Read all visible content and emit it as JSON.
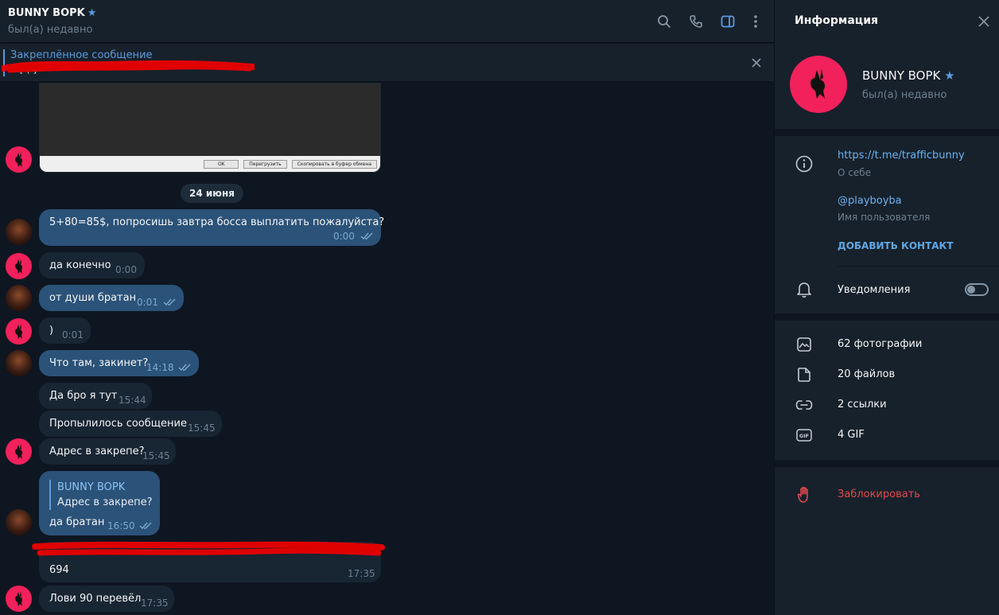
{
  "header": {
    "name": "BUNNY BOPK",
    "status": "был(а) недавно"
  },
  "pinned": {
    "title": "Закреплённое сообщение",
    "text": "1 [  (             ]"
  },
  "screenshot": {
    "ok_label": "OK",
    "reload_label": "Перегрузить",
    "copy_label": "Скопировать в буфер обмена"
  },
  "date_chip": "24 июня",
  "messages": [
    {
      "text": "5+80=85$, попросишь завтра босса выплатить пожалуйста?",
      "time": "0:00"
    },
    {
      "text": "да конечно",
      "time": "0:00"
    },
    {
      "text": "от души братан",
      "time": "0:01"
    },
    {
      "text": ")",
      "time": "0:01"
    },
    {
      "text": "Что там, закинет?",
      "time": "14:18"
    },
    {
      "text": "Да бро я тут",
      "time": "15:44"
    },
    {
      "text": "Пропылилось сообщение",
      "time": "15:45"
    },
    {
      "text": "Адрес в закрепе?",
      "time": "15:45"
    },
    {
      "text": "да братан",
      "time": "16:50",
      "reply_name": "BUNNY BOPK",
      "reply_text": "Адрес в закрепе?"
    },
    {
      "text": "694",
      "time": "17:35"
    },
    {
      "text": "Лови 90 перевёл",
      "time": "17:35"
    }
  ],
  "info": {
    "title": "Информация",
    "name": "BUNNY BOPK",
    "status": "был(а) недавно",
    "link": "https://t.me/trafficbunny",
    "link_label": "О себе",
    "username": "@playboyba",
    "username_label": "Имя пользователя",
    "add_contact": "ДОБАВИТЬ КОНТАКТ",
    "notifications": "Уведомления",
    "notifications_on": false,
    "photos": "62 фотографии",
    "files": "20 файлов",
    "links": "2 ссылки",
    "gifs": "4 GIF",
    "block": "Заблокировать"
  },
  "colors": {
    "accent": "#5a9be0",
    "outgoing_bubble": "#2b5278",
    "incoming_bubble": "#182533",
    "avatar_pink": "#f2215b",
    "danger": "#e5484d"
  }
}
